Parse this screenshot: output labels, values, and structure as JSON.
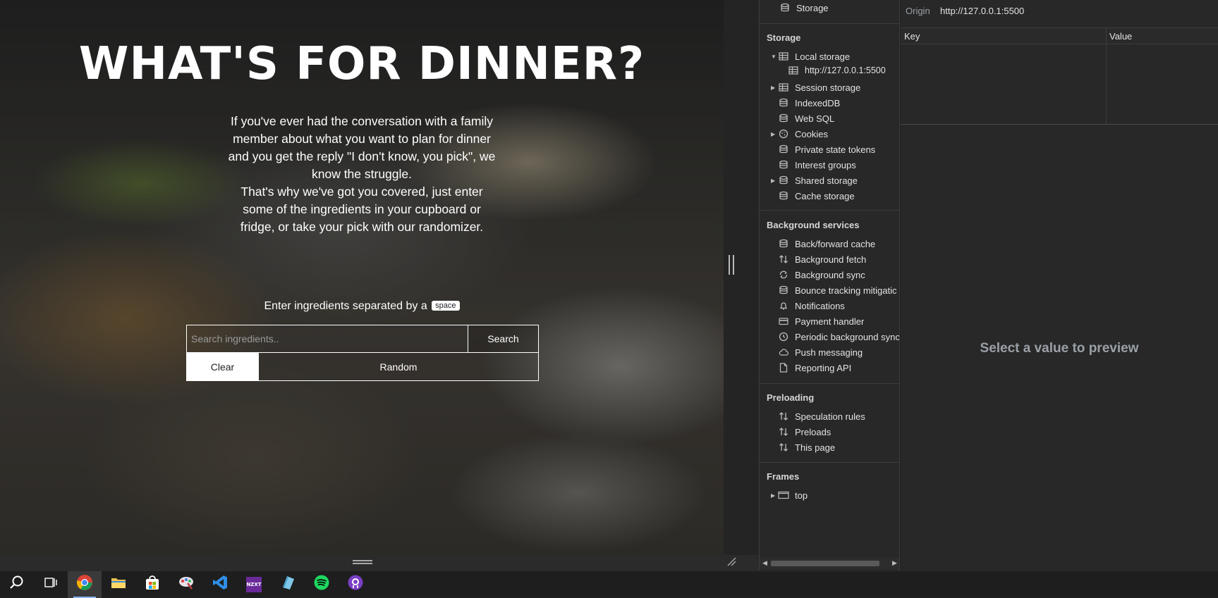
{
  "page": {
    "title": "WHAT'S FOR DINNER?",
    "description_lines": [
      "If you've ever had the conversation with a family member about what you want to plan for dinner and you get the reply \"I don't know, you pick\", we know the struggle.",
      "That's why we've got you covered, just enter some of the ingredients in your cupboard or fridge, or take your pick with our randomizer."
    ],
    "ingredient_label": "Enter ingredients separated by a",
    "ingredient_key": "space",
    "search_placeholder": "Search ingredients..",
    "search_value": "",
    "search_button": "Search",
    "clear_button": "Clear",
    "random_button": "Random"
  },
  "devtools": {
    "top_item": "Storage",
    "sections": {
      "storage": {
        "title": "Storage",
        "items": [
          {
            "label": "Local storage",
            "icon": "table-icon",
            "expanded": true
          },
          {
            "label": "http://127.0.0.1:5500",
            "icon": "table-icon"
          },
          {
            "label": "Session storage",
            "icon": "table-icon",
            "expandable": true
          },
          {
            "label": "IndexedDB",
            "icon": "database-icon"
          },
          {
            "label": "Web SQL",
            "icon": "database-icon"
          },
          {
            "label": "Cookies",
            "icon": "cookie-icon",
            "expandable": true
          },
          {
            "label": "Private state tokens",
            "icon": "database-icon"
          },
          {
            "label": "Interest groups",
            "icon": "database-icon"
          },
          {
            "label": "Shared storage",
            "icon": "database-icon",
            "expandable": true
          },
          {
            "label": "Cache storage",
            "icon": "database-icon"
          }
        ]
      },
      "background": {
        "title": "Background services",
        "items": [
          {
            "label": "Back/forward cache",
            "icon": "database-icon"
          },
          {
            "label": "Background fetch",
            "icon": "updown-arrows-icon"
          },
          {
            "label": "Background sync",
            "icon": "sync-icon"
          },
          {
            "label": "Bounce tracking mitigatic",
            "icon": "database-icon"
          },
          {
            "label": "Notifications",
            "icon": "bell-icon"
          },
          {
            "label": "Payment handler",
            "icon": "card-icon"
          },
          {
            "label": "Periodic background sync",
            "icon": "clock-icon"
          },
          {
            "label": "Push messaging",
            "icon": "cloud-icon"
          },
          {
            "label": "Reporting API",
            "icon": "document-icon"
          }
        ]
      },
      "preloading": {
        "title": "Preloading",
        "items": [
          {
            "label": "Speculation rules",
            "icon": "updown-arrows-icon"
          },
          {
            "label": "Preloads",
            "icon": "updown-arrows-icon"
          },
          {
            "label": "This page",
            "icon": "updown-arrows-icon"
          }
        ]
      },
      "frames": {
        "title": "Frames",
        "items": [
          {
            "label": "top",
            "icon": "frame-icon",
            "expandable": true
          }
        ]
      }
    },
    "origin_label": "Origin",
    "origin_value": "http://127.0.0.1:5500",
    "table": {
      "key_header": "Key",
      "value_header": "Value"
    },
    "preview_placeholder": "Select a value to preview"
  },
  "taskbar": {
    "apps": [
      "search-icon",
      "task-view-icon",
      "chrome-icon",
      "file-explorer-icon",
      "store-icon",
      "paint-icon",
      "vscode-icon",
      "nzxt-icon",
      "notepad-icon",
      "spotify-icon",
      "github-desktop-icon"
    ],
    "nzxt_label": "NZXT"
  }
}
